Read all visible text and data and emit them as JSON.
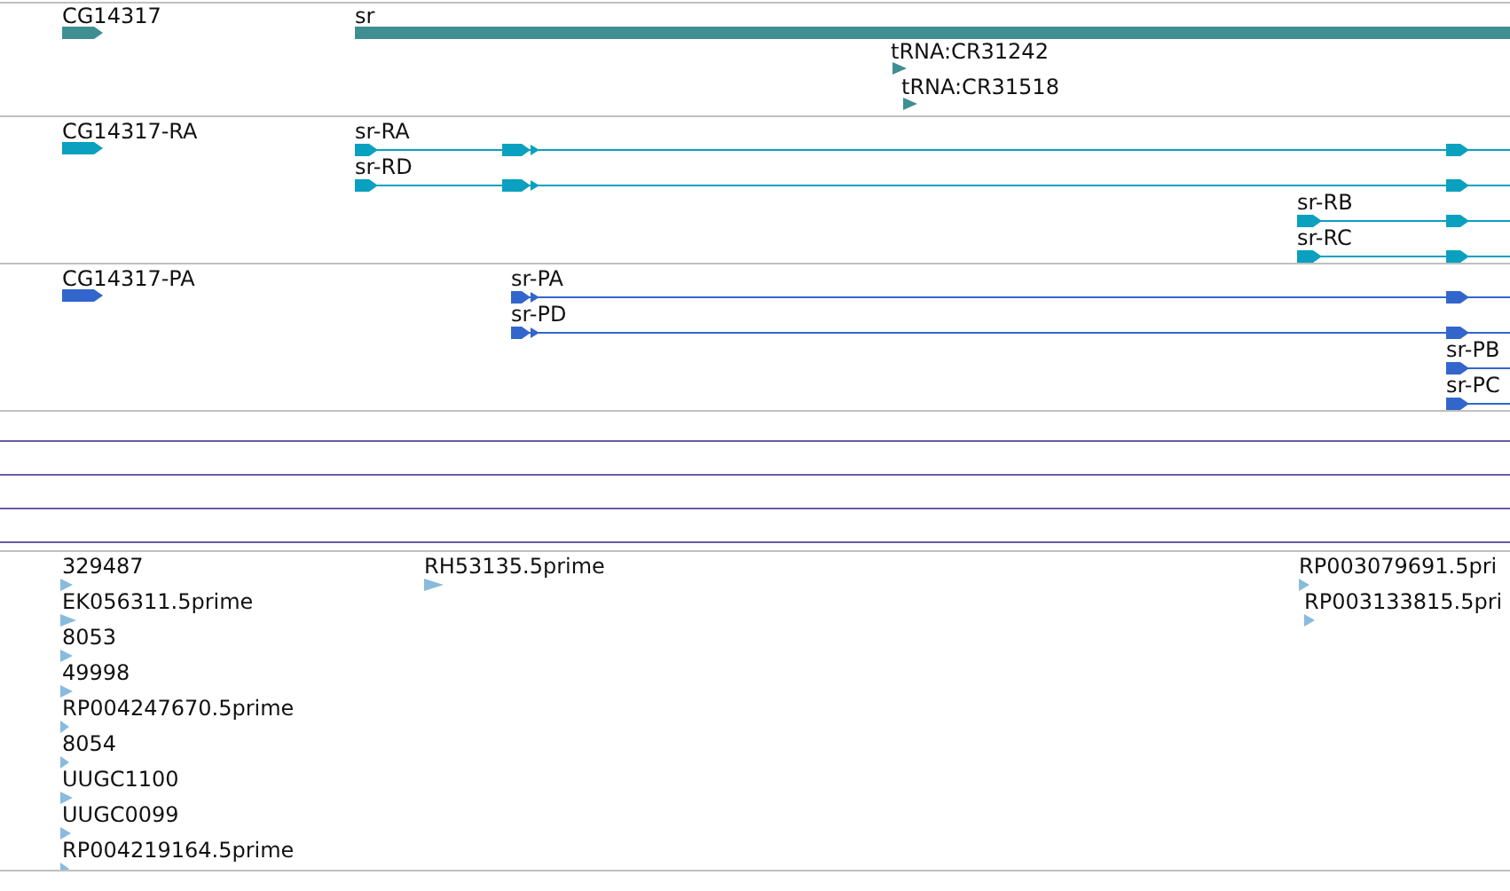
{
  "tracks": [
    {
      "kind": "features",
      "color": "#3f8f92",
      "features": [
        {
          "label": "CG14317",
          "kind": "gene"
        },
        {
          "label": "sr",
          "kind": "gene"
        },
        {
          "label": "tRNA:CR31242",
          "kind": "marker"
        },
        {
          "label": "tRNA:CR31518",
          "kind": "marker"
        }
      ]
    },
    {
      "kind": "features",
      "color": "#0aa0c0",
      "features": [
        {
          "label": "CG14317-RA",
          "kind": "gene"
        },
        {
          "label": "sr-RA",
          "kind": "transcript"
        },
        {
          "label": "sr-RD",
          "kind": "transcript"
        },
        {
          "label": "sr-RB",
          "kind": "transcript"
        },
        {
          "label": "sr-RC",
          "kind": "transcript"
        }
      ]
    },
    {
      "kind": "features",
      "color": "#3366cc",
      "features": [
        {
          "label": "CG14317-PA",
          "kind": "gene"
        },
        {
          "label": "sr-PA",
          "kind": "transcript"
        },
        {
          "label": "sr-PD",
          "kind": "transcript"
        },
        {
          "label": "sr-PB",
          "kind": "transcript"
        },
        {
          "label": "sr-PC",
          "kind": "transcript"
        }
      ]
    },
    {
      "kind": "empty"
    },
    {
      "kind": "empty"
    },
    {
      "kind": "empty"
    },
    {
      "kind": "empty"
    },
    {
      "kind": "features",
      "color": "#88bbdd",
      "features": [
        {
          "label": "329487",
          "kind": "marker"
        },
        {
          "label": "EK056311.5prime",
          "kind": "marker"
        },
        {
          "label": "8053",
          "kind": "marker"
        },
        {
          "label": "49998",
          "kind": "marker"
        },
        {
          "label": "RP004247670.5prime",
          "kind": "marker"
        },
        {
          "label": "8054",
          "kind": "marker"
        },
        {
          "label": "UUGC1100",
          "kind": "marker"
        },
        {
          "label": "UUGC0099",
          "kind": "marker"
        },
        {
          "label": "RP004219164.5prime",
          "kind": "marker"
        },
        {
          "label": "RH53135.5prime",
          "kind": "marker"
        },
        {
          "label": "RP003079691.5pri",
          "kind": "marker"
        },
        {
          "label": "RP003133815.5pri",
          "kind": "marker"
        }
      ]
    }
  ]
}
